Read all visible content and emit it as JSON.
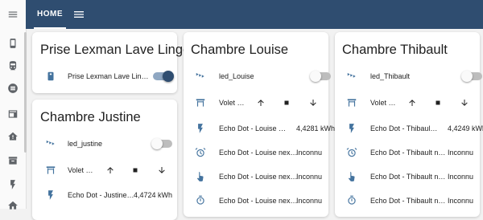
{
  "topbar": {
    "home_tab": "HOME"
  },
  "rail": {
    "icons": [
      "menu-icon",
      "devices-icon",
      "train-icon",
      "list-icon",
      "calendar-settings-icon",
      "home-alert-icon",
      "archive-icon",
      "flash-icon",
      "home-icon"
    ]
  },
  "cards": {
    "prise": {
      "title": "Prise Lexman Lave Linge",
      "rows": [
        {
          "label": "Prise Lexman Lave Lin…",
          "state": "on"
        }
      ]
    },
    "justine": {
      "title": "Chambre Justine",
      "rows": [
        {
          "label": "led_justine",
          "state": "off"
        },
        {
          "label": "Volet …"
        },
        {
          "label": "Echo Dot - Justine…",
          "value": "4,4724 kWh"
        }
      ]
    },
    "louise": {
      "title": "Chambre Louise",
      "rows": [
        {
          "label": "led_Louise",
          "state": "off"
        },
        {
          "label": "Volet …"
        },
        {
          "label": "Echo Dot - Louise …",
          "value": "4,4281 kWh"
        },
        {
          "label": "Echo Dot - Louise nex…",
          "value": "Inconnu"
        },
        {
          "label": "Echo Dot - Louise nex…",
          "value": "Inconnu"
        },
        {
          "label": "Echo Dot - Louise nex…",
          "value": "Inconnu"
        }
      ]
    },
    "thibault": {
      "title": "Chambre Thibault",
      "rows": [
        {
          "label": "led_Thibault",
          "state": "off"
        },
        {
          "label": "Volet …"
        },
        {
          "label": "Echo Dot - Thibaul…",
          "value": "4,4249 kWh"
        },
        {
          "label": "Echo Dot - Thibault n…",
          "value": "Inconnu"
        },
        {
          "label": "Echo Dot - Thibault n…",
          "value": "Inconnu"
        },
        {
          "label": "Echo Dot - Thibault n…",
          "value": "Inconnu"
        }
      ]
    }
  },
  "colors": {
    "header": "#2f4d70",
    "icon": "#44739e",
    "toggle_on": "#2f4d70",
    "toggle_off": "#bdbdbd"
  }
}
